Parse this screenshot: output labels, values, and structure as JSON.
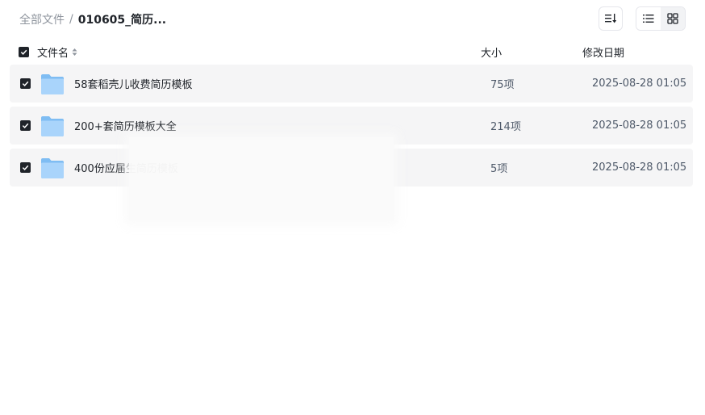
{
  "breadcrumb": {
    "root": "全部文件",
    "separator": "/",
    "current": "010605_简历..."
  },
  "header": {
    "name": "文件名",
    "size": "大小",
    "date": "修改日期"
  },
  "rows": [
    {
      "name": "58套稻壳儿收费简历模板",
      "size": "75项",
      "date": "2025-08-28 01:05"
    },
    {
      "name": "200+套简历模板大全",
      "size": "214项",
      "date": "2025-08-28 01:05"
    },
    {
      "name": "400份应届生简历模板",
      "size": "5项",
      "date": "2025-08-28 01:05"
    }
  ],
  "icons": {
    "sort": "sort-icon",
    "list_view": "list-view-icon",
    "grid_view": "grid-view-icon",
    "folder": "folder-icon"
  },
  "colors": {
    "folder_light": "#a9d4fb",
    "folder_dark": "#7fbdf3",
    "row_bg": "#f5f5f6",
    "checkbox": "#1f2329"
  }
}
